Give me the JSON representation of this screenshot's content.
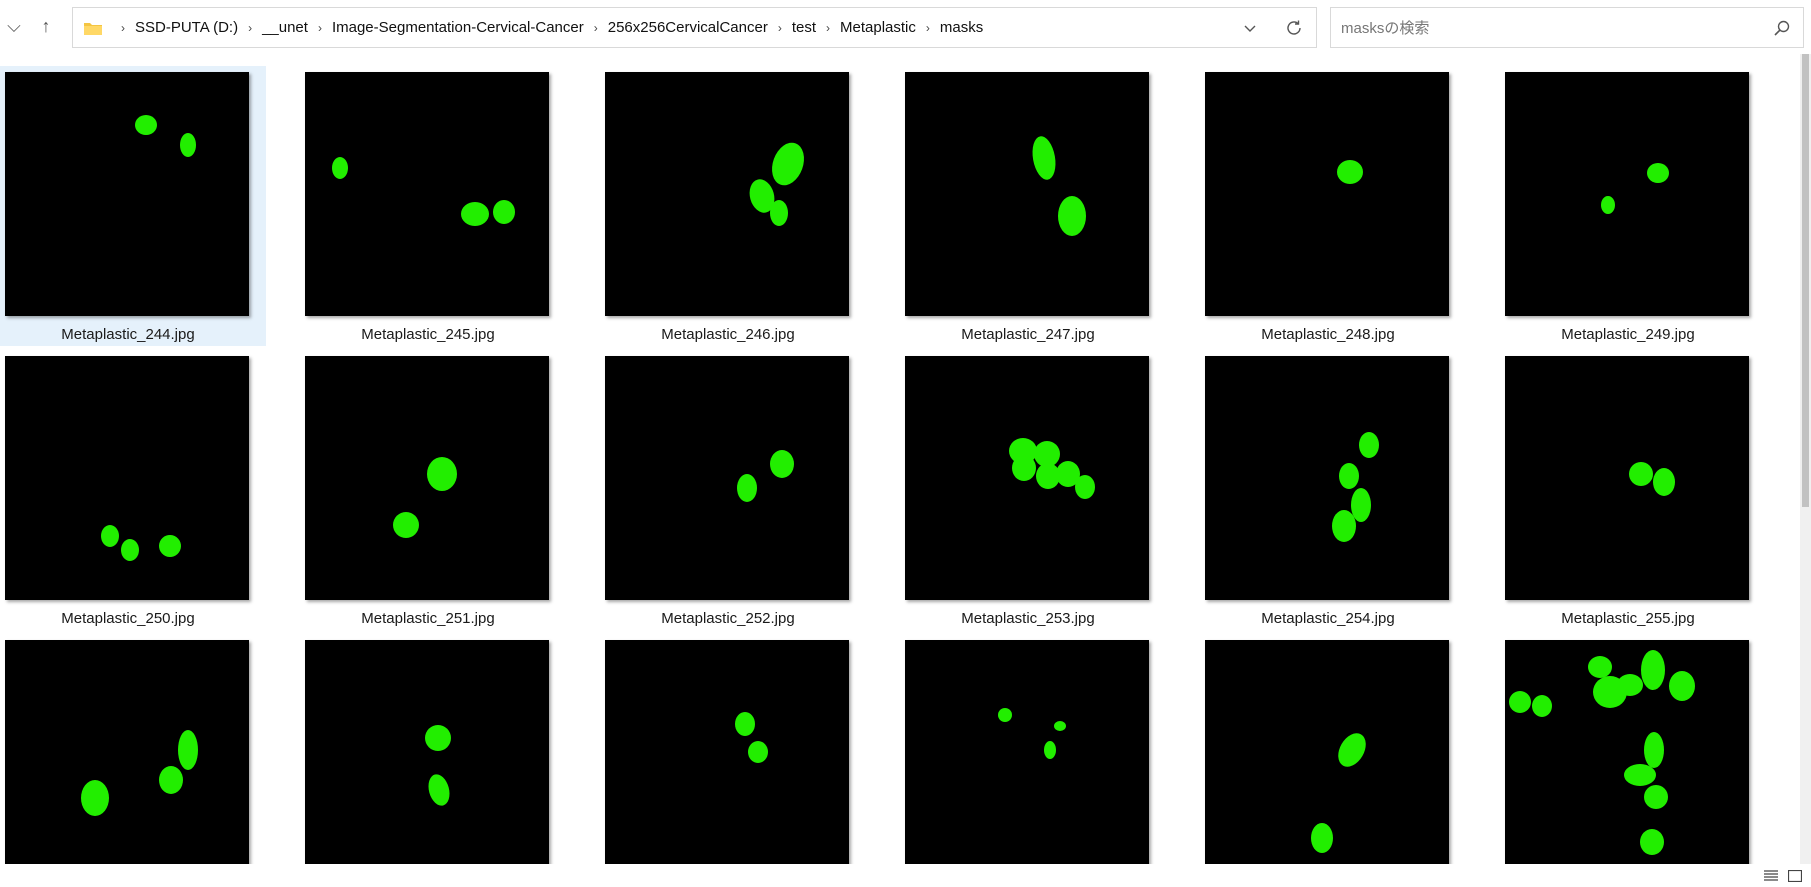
{
  "toolbar": {
    "chevron_glyph": "⌵",
    "up_glyph": "↑"
  },
  "address": {
    "crumbs": [
      "SSD-PUTA (D:)",
      "__unet",
      "Image-Segmentation-Cervical-Cancer",
      "256x256CervicalCancer",
      "test",
      "Metaplastic",
      "masks"
    ],
    "separator": "›"
  },
  "search": {
    "placeholder": "masksの検索"
  },
  "colors": {
    "mask_fill": "#22ee00",
    "thumb_bg": "#000000",
    "selection": "#e5f1fb"
  },
  "files": [
    {
      "name": "Metaplastic_244.jpg",
      "selected": true
    },
    {
      "name": "Metaplastic_245.jpg"
    },
    {
      "name": "Metaplastic_246.jpg"
    },
    {
      "name": "Metaplastic_247.jpg"
    },
    {
      "name": "Metaplastic_248.jpg"
    },
    {
      "name": "Metaplastic_249.jpg"
    },
    {
      "name": "Metaplastic_250.jpg"
    },
    {
      "name": "Metaplastic_251.jpg"
    },
    {
      "name": "Metaplastic_252.jpg"
    },
    {
      "name": "Metaplastic_253.jpg"
    },
    {
      "name": "Metaplastic_254.jpg"
    },
    {
      "name": "Metaplastic_255.jpg"
    },
    {
      "name": ""
    },
    {
      "name": ""
    },
    {
      "name": ""
    },
    {
      "name": ""
    },
    {
      "name": ""
    },
    {
      "name": ""
    }
  ],
  "statusbar": {
    "details_view_icon": "list-view-icon",
    "large_icons_view_icon": "tiles-view-icon"
  }
}
